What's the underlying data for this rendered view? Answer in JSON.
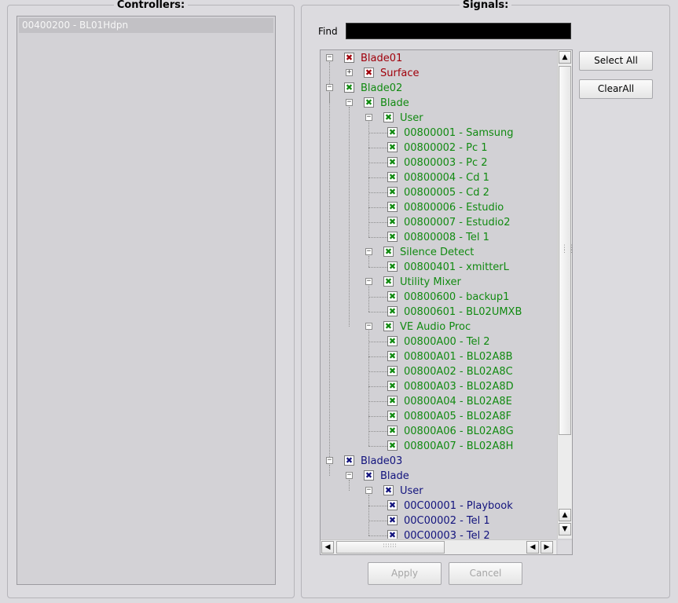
{
  "controllers": {
    "title": "Controllers:",
    "items": [
      "00400200 - BL01Hdpn"
    ]
  },
  "signals": {
    "title": "Signals:",
    "find_label": "Find",
    "find_value": "",
    "select_all_label": "Select All",
    "clear_all_label": "ClearAll",
    "apply_label": "Apply",
    "cancel_label": "Cancel",
    "tree": [
      {
        "label": "Blade01",
        "level": 0,
        "color": "red",
        "expander": "minus"
      },
      {
        "label": "Surface",
        "level": 1,
        "color": "red",
        "expander": "plus"
      },
      {
        "label": "Blade02",
        "level": 0,
        "color": "green",
        "expander": "minus"
      },
      {
        "label": "Blade",
        "level": 1,
        "color": "green",
        "expander": "minus"
      },
      {
        "label": "User",
        "level": 2,
        "color": "green",
        "expander": "minus"
      },
      {
        "label": "00800001 - Samsung",
        "level": 3,
        "color": "green",
        "expander": ""
      },
      {
        "label": "00800002 - Pc 1",
        "level": 3,
        "color": "green",
        "expander": ""
      },
      {
        "label": "00800003 - Pc 2",
        "level": 3,
        "color": "green",
        "expander": ""
      },
      {
        "label": "00800004 - Cd 1",
        "level": 3,
        "color": "green",
        "expander": ""
      },
      {
        "label": "00800005 - Cd 2",
        "level": 3,
        "color": "green",
        "expander": ""
      },
      {
        "label": "00800006 - Estudio",
        "level": 3,
        "color": "green",
        "expander": ""
      },
      {
        "label": "00800007 - Estudio2",
        "level": 3,
        "color": "green",
        "expander": ""
      },
      {
        "label": "00800008 - Tel 1",
        "level": 3,
        "color": "green",
        "expander": ""
      },
      {
        "label": "Silence Detect",
        "level": 2,
        "color": "green",
        "expander": "minus"
      },
      {
        "label": "00800401 - xmitterL",
        "level": 3,
        "color": "green",
        "expander": ""
      },
      {
        "label": "Utility Mixer",
        "level": 2,
        "color": "green",
        "expander": "minus"
      },
      {
        "label": "00800600 - backup1",
        "level": 3,
        "color": "green",
        "expander": ""
      },
      {
        "label": "00800601 - BL02UMXB",
        "level": 3,
        "color": "green",
        "expander": ""
      },
      {
        "label": "VE Audio Proc",
        "level": 2,
        "color": "green",
        "expander": "minus"
      },
      {
        "label": "00800A00 - Tel 2",
        "level": 3,
        "color": "green",
        "expander": ""
      },
      {
        "label": "00800A01 - BL02A8B",
        "level": 3,
        "color": "green",
        "expander": ""
      },
      {
        "label": "00800A02 - BL02A8C",
        "level": 3,
        "color": "green",
        "expander": ""
      },
      {
        "label": "00800A03 - BL02A8D",
        "level": 3,
        "color": "green",
        "expander": ""
      },
      {
        "label": "00800A04 - BL02A8E",
        "level": 3,
        "color": "green",
        "expander": ""
      },
      {
        "label": "00800A05 - BL02A8F",
        "level": 3,
        "color": "green",
        "expander": ""
      },
      {
        "label": "00800A06 - BL02A8G",
        "level": 3,
        "color": "green",
        "expander": ""
      },
      {
        "label": "00800A07 - BL02A8H",
        "level": 3,
        "color": "green",
        "expander": ""
      },
      {
        "label": "Blade03",
        "level": 0,
        "color": "blue",
        "expander": "minus"
      },
      {
        "label": "Blade",
        "level": 1,
        "color": "blue",
        "expander": "minus"
      },
      {
        "label": "User",
        "level": 2,
        "color": "blue",
        "expander": "minus"
      },
      {
        "label": "00C00001 - Playbook",
        "level": 3,
        "color": "blue",
        "expander": ""
      },
      {
        "label": "00C00002 - Tel 1",
        "level": 3,
        "color": "blue",
        "expander": ""
      },
      {
        "label": "00C00003 - Tel 2",
        "level": 3,
        "color": "blue",
        "expander": ""
      }
    ],
    "check_glyph": "✖",
    "expander_glyphs": {
      "minus": "−",
      "plus": "+"
    },
    "scroll_icons": {
      "up": "▲",
      "down": "▼",
      "left": "◀",
      "right": "▶"
    }
  },
  "colors": {
    "red": "#a0000b",
    "green": "#118a11",
    "blue": "#12137d"
  }
}
